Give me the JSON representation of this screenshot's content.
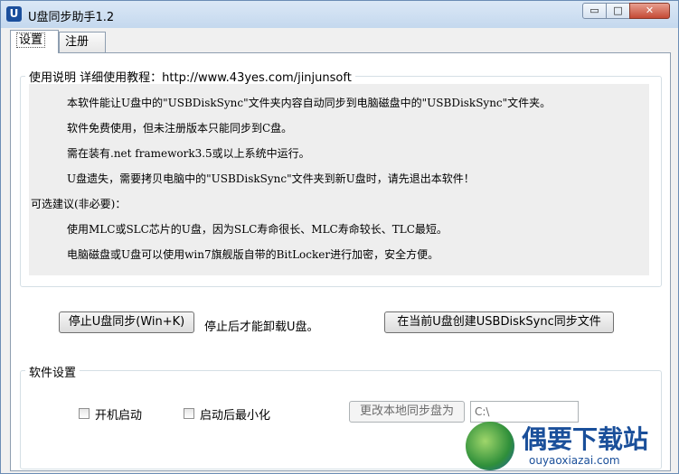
{
  "window": {
    "title": "U盘同步助手1.2",
    "app_icon_letter": "U",
    "min_glyph": "▭",
    "max_glyph": "□",
    "close_glyph": "✕"
  },
  "tabs": [
    {
      "label": "设置",
      "active": true
    },
    {
      "label": "注册",
      "active": false
    }
  ],
  "usage": {
    "group_label": "使用说明    详细使用教程：http://www.43yes.com/jinjunsoft",
    "lines": [
      "本软件能让U盘中的\"USBDiskSync\"文件夹内容自动同步到电脑磁盘中的\"USBDiskSync\"文件夹。",
      "软件免费使用，但未注册版本只能同步到C盘。",
      "需在装有.net framework3.5或以上系统中运行。",
      "U盘遗失，需要拷贝电脑中的\"USBDiskSync\"文件夹到新U盘时，请先退出本软件！",
      "可选建议(非必要)：",
      "使用MLC或SLC芯片的U盘，因为SLC寿命很长、MLC寿命较长、TLC最短。",
      "电脑磁盘或U盘可以使用win7旗舰版自带的BitLocker进行加密，安全方便。"
    ]
  },
  "actions": {
    "stop_sync_button": "停止U盘同步(Win+K)",
    "stop_note": "停止后才能卸载U盘。",
    "create_folder_button": "在当前U盘创建USBDiskSync同步文件"
  },
  "settings": {
    "group_label": "软件设置",
    "autostart_label": "开机启动",
    "autostart_checked": false,
    "minimize_label": "启动后最小化",
    "minimize_checked": false,
    "change_disk_button": "更改本地同步盘为",
    "local_path": "C:\\"
  },
  "watermark": {
    "brand": "偶要下载站",
    "url": "ouyaoxiazai.com"
  },
  "colors": {
    "accent": "#1a4f9a",
    "titlebar": "#c4d8ee",
    "close": "#c44a35"
  }
}
